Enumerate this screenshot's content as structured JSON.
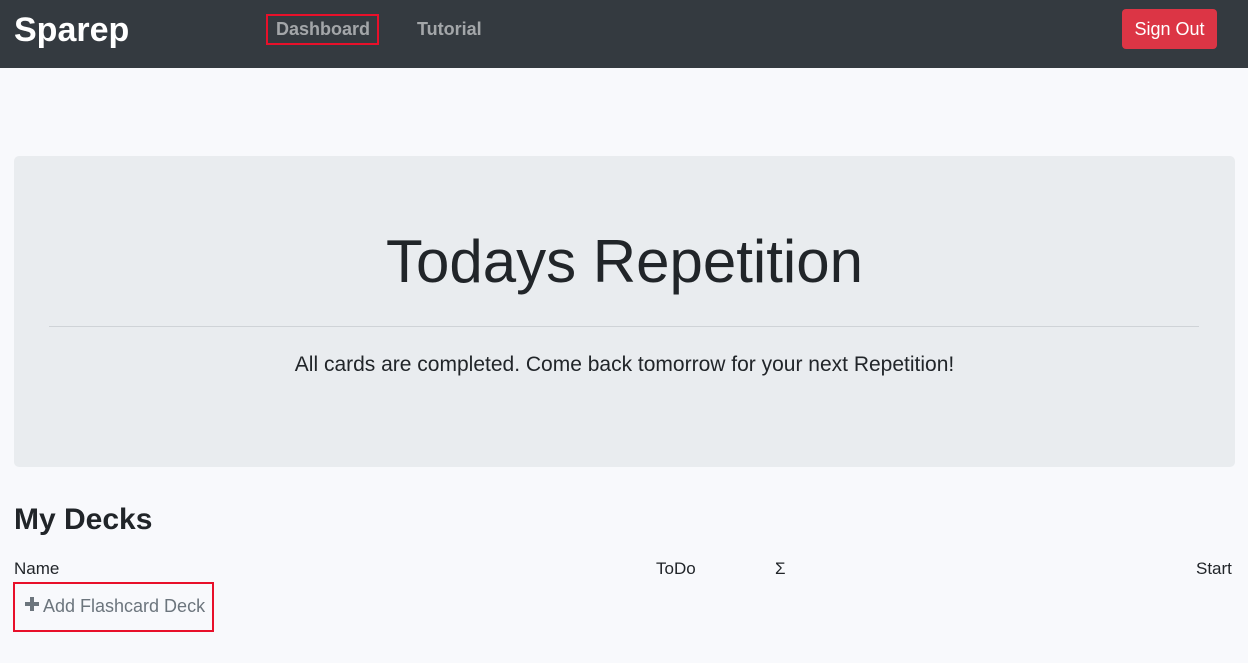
{
  "navbar": {
    "brand": "Sparep",
    "links": [
      {
        "label": "Dashboard"
      },
      {
        "label": "Tutorial"
      }
    ],
    "signout_label": "Sign Out"
  },
  "jumbotron": {
    "title": "Todays Repetition",
    "message": "All cards are completed. Come back tomorrow for your next Repetition!"
  },
  "decks": {
    "title": "My Decks",
    "columns": [
      "Name",
      "ToDo",
      "Σ",
      "Start"
    ],
    "add_label": "Add Flashcard Deck",
    "add_icon": "plus-icon"
  },
  "colors": {
    "navbar_bg": "#343a40",
    "signout_bg": "#dc3545",
    "highlight_border": "#e8102a",
    "jumbotron_bg": "#e9ecef"
  }
}
